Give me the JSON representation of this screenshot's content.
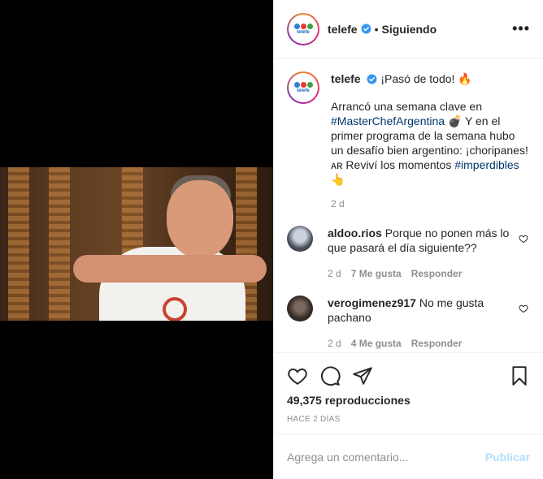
{
  "colors": {
    "telefe_dot1": "#2f7fd1",
    "telefe_dot2": "#e53935",
    "telefe_dot3": "#43a047",
    "link": "#00376b",
    "publish": "#b2dffc"
  },
  "header": {
    "username": "telefe",
    "separator": "•",
    "follow_state": "Siguiendo",
    "more": "•••"
  },
  "avatar_label": "telefe",
  "caption": {
    "username": "telefe",
    "title": "¡Pasó de todo! 🔥",
    "line1": "Arrancó una semana clave en",
    "hashtag1": "#MasterChefArgentina",
    "line2": " 💣 Y en el primer programa de la semana hubo un desafío bien argentino: ¡choripanes! ᴀʀ Reviví los momentos ",
    "hashtag2": "#imperdibles",
    "line3": " 👆",
    "time": "2 d"
  },
  "comments": [
    {
      "username": "aldoo.rios",
      "text": "Porque no ponen más lo que pasará el día siguiente??",
      "time": "2 d",
      "likes": "7 Me gusta",
      "reply": "Responder"
    },
    {
      "username": "verogimenez917",
      "text": "No me gusta pachano",
      "time": "2 d",
      "likes": "4 Me gusta",
      "reply": "Responder"
    }
  ],
  "stats": {
    "views": "49,375 reproducciones",
    "posted": "HACE 2 DÍAS"
  },
  "add_comment": {
    "placeholder": "Agrega un comentario...",
    "publish": "Publicar"
  }
}
